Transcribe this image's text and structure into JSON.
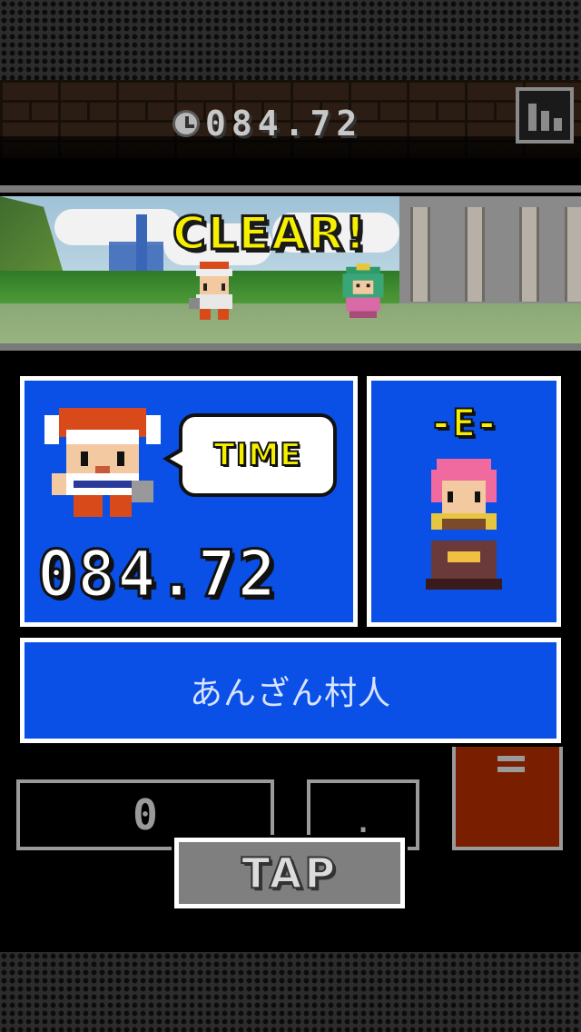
{
  "hud": {
    "timer_value": "084.72",
    "clock_icon": "clock-icon",
    "stats_icon": "bar-chart-icon"
  },
  "scene": {
    "clear_text": "CLEAR!"
  },
  "result": {
    "time_label": "TIME",
    "time_value": "084.72",
    "rank_label": "-E-",
    "player_name": "あんざん村人"
  },
  "input": {
    "integer_value": "0",
    "decimal_value": ".",
    "tap_label": "TAP",
    "menu_icon": "menu-lines-icon"
  },
  "colors": {
    "panel_blue": "#0a4fe6",
    "accent_yellow": "#f6f000",
    "side_block_red": "#7a1e00"
  }
}
